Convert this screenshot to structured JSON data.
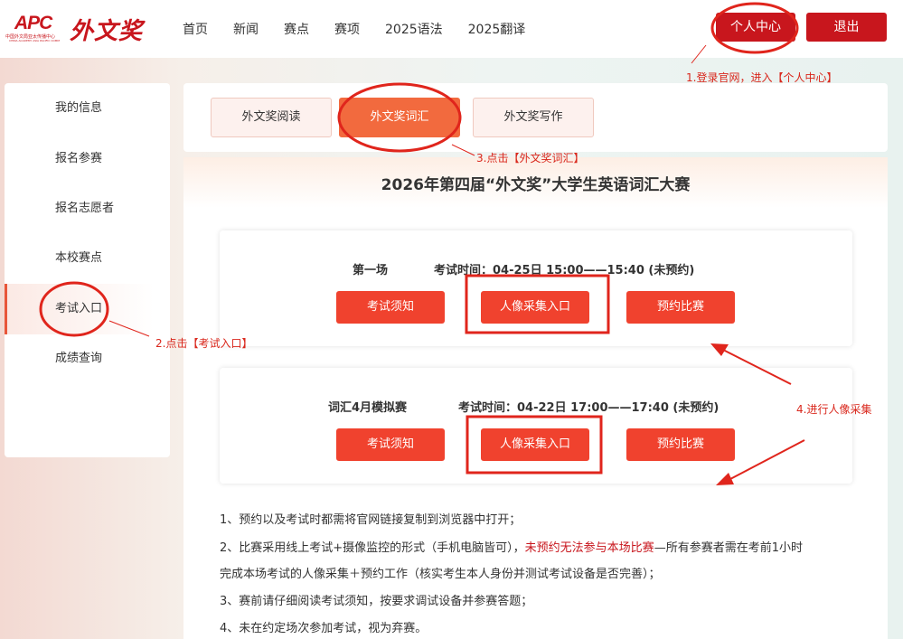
{
  "header": {
    "logo_apc": "APC",
    "logo_apc_sub": "中国外文局亚太传播中心",
    "logo_apc_sub2": "CHINA ACADEMY ASIA PACIFIC COMM",
    "logo_text": "外文奖",
    "nav": [
      "首页",
      "新闻",
      "赛点",
      "赛项",
      "2025语法",
      "2025翻译"
    ],
    "user_center": "个人中心",
    "logout": "退出"
  },
  "sidebar": {
    "items": [
      {
        "label": "我的信息"
      },
      {
        "label": "报名参赛"
      },
      {
        "label": "报名志愿者"
      },
      {
        "label": "本校赛点"
      },
      {
        "label": "考试入口"
      },
      {
        "label": "成绩查询"
      }
    ]
  },
  "tabs": [
    "外文奖阅读",
    "外文奖词汇",
    "外文奖写作"
  ],
  "main": {
    "title": "2026年第四届“外文奖”大学生英语词汇大赛",
    "exams": [
      {
        "name": "第一场",
        "time": "考试时间：04-25日 15:00——15:40 (未预约)",
        "buttons": [
          "考试须知",
          "人像采集入口",
          "预约比赛"
        ]
      },
      {
        "name": "词汇4月模拟赛",
        "time": "考试时间：04-22日 17:00——17:40 (未预约)",
        "buttons": [
          "考试须知",
          "人像采集入口",
          "预约比赛"
        ]
      }
    ],
    "notes": {
      "n1": "1、预约以及考试时都需将官网链接复制到浏览器中打开；",
      "n2a": "2、比赛采用线上考试+摄像监控的形式（手机电脑皆可），",
      "n2red": "未预约无法参与本场比赛",
      "n2b": "—所有参赛者需在考前1小时",
      "n2c": "完成本场考试的人像采集＋预约工作（核实考生本人身份并测试考试设备是否完善）；",
      "n3": "3、赛前请仔细阅读考试须知，按要求调试设备并参赛答题；",
      "n4": "4、未在约定场次参加考试，视为弃赛。"
    }
  },
  "annotations": {
    "a1": "1.登录官网，进入【个人中心】",
    "a2": "2.点击【考试入口】",
    "a3": "3.点击【外文奖词汇】",
    "a4": "4.进行人像采集"
  },
  "colors": {
    "brand_red": "#c8161d",
    "orange": "#f26a3e",
    "button_red": "#f0422e",
    "annotation_red": "#d9271c"
  }
}
